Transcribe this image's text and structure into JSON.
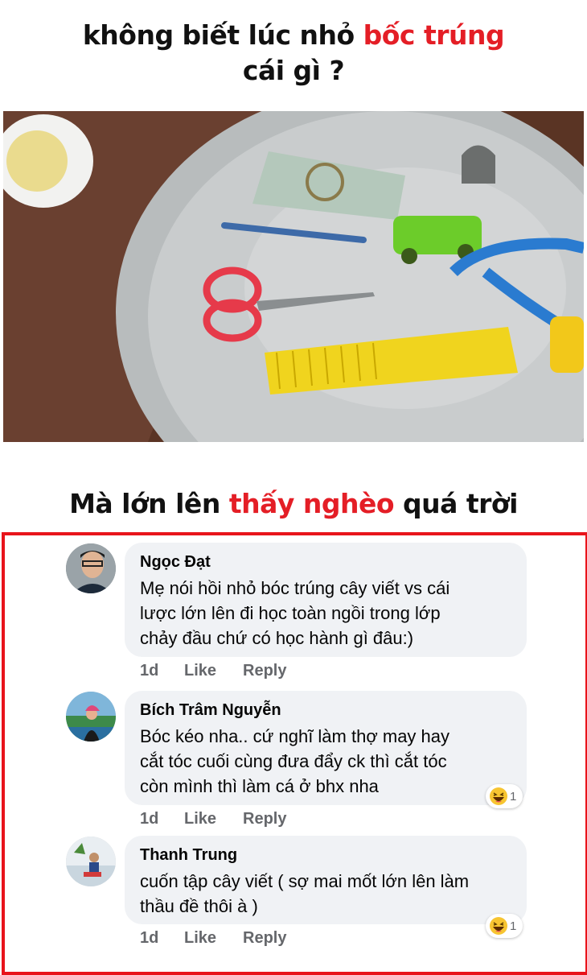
{
  "top_title": {
    "line1_black": "không biết lúc nhỏ ",
    "line1_red": "bốc trúng",
    "line2": "cái gì ?"
  },
  "bottom_title": {
    "part1": "Mà lớn lên ",
    "part_red": "thấy nghèo",
    "part2": " quá trời"
  },
  "comments": [
    {
      "author": "Ngọc Đạt",
      "lines": [
        "Mẹ nói hồi nhỏ bóc trúng cây viết vs cái",
        "lược lớn lên đi học toàn ngồi trong lớp",
        "chảy đầu chứ có học hành gì đâu:)"
      ],
      "time": "1d",
      "like": "Like",
      "reply": "Reply"
    },
    {
      "author": "Bích Trâm Nguyễn",
      "lines": [
        "Bóc kéo nha.. cứ nghĩ làm thợ may hay",
        "cắt tóc cuối cùng đưa đẩy ck thì cắt tóc",
        "còn mình thì làm cá ở bhx nha"
      ],
      "time": "1d",
      "like": "Like",
      "reply": "Reply",
      "reaction": {
        "icon": "haha-emoji-icon",
        "count": "1"
      }
    },
    {
      "author": "Thanh Trung",
      "lines": [
        "cuốn tập cây viết ( sợ mai mốt lớn lên làm",
        "thầu đề thôi à )"
      ],
      "time": "1d",
      "like": "Like",
      "reply": "Reply",
      "reaction": {
        "icon": "haha-emoji-icon",
        "count": "1"
      }
    }
  ],
  "colors": {
    "accent_red": "#e41e26",
    "highlight_border": "#e8141b",
    "bubble_bg": "#f0f2f5",
    "meta_text": "#65676b"
  }
}
